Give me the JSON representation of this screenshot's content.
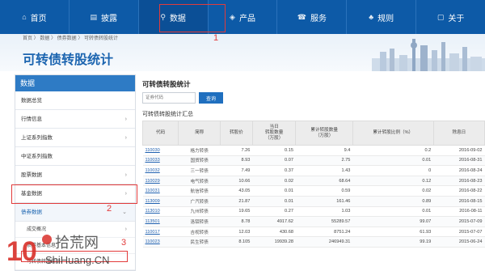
{
  "nav": [
    {
      "icon": "home-icon",
      "glyph": "⌂",
      "label": "首页"
    },
    {
      "icon": "disclosure-icon",
      "glyph": "▤",
      "label": "披露"
    },
    {
      "icon": "data-icon",
      "glyph": "⚲",
      "label": "数据"
    },
    {
      "icon": "product-icon",
      "glyph": "◈",
      "label": "产品"
    },
    {
      "icon": "service-icon",
      "glyph": "☎",
      "label": "服务"
    },
    {
      "icon": "rules-icon",
      "glyph": "♣",
      "label": "规则"
    },
    {
      "icon": "about-icon",
      "glyph": "▢",
      "label": "关于"
    }
  ],
  "breadcrumb": "首页 〉 数据 〉 债券数据 〉 可转债转股统计",
  "page_title": "可转债转股统计",
  "sidebar": {
    "header": "数据",
    "items": [
      {
        "label": "数据总览",
        "chevron": ""
      },
      {
        "label": "行情信息",
        "chevron": "›"
      },
      {
        "label": "上证系列指数",
        "chevron": "›"
      },
      {
        "label": "中证系列指数",
        "chevron": ""
      },
      {
        "label": "股票数据",
        "chevron": "›"
      },
      {
        "label": "基金数据",
        "chevron": "›"
      },
      {
        "label": "债券数据",
        "chevron": "⌄"
      }
    ],
    "subitems": [
      {
        "label": "成交概况",
        "chevron": "›"
      },
      {
        "label": "债券基本信息",
        "chevron": ""
      },
      {
        "label": "可转债转股统计",
        "chevron": ""
      }
    ]
  },
  "main": {
    "title": "可转债转股统计",
    "search_placeholder": "证券代码",
    "search_button": "查询",
    "summary_title": "可转债转股统计汇总",
    "columns": [
      "代码",
      "简称",
      "转股价",
      "当日\n转股数量\n（万股）",
      "累计转股数量\n（万股）",
      "累计转股比例（%）",
      "除息日"
    ],
    "rows": [
      [
        "110030",
        "格力转债",
        "7.26",
        "0.15",
        "9.4",
        "0.2",
        "2016-09-02"
      ],
      [
        "110033",
        "国贸转债",
        "8.93",
        "0.07",
        "2.75",
        "0.01",
        "2016-08-31"
      ],
      [
        "110032",
        "三一转债",
        "7.49",
        "0.37",
        "1.43",
        "0",
        "2016-08-24"
      ],
      [
        "110029",
        "电气转债",
        "10.66",
        "0.02",
        "68.64",
        "0.12",
        "2016-08-23"
      ],
      [
        "110031",
        "航信转债",
        "43.05",
        "0.01",
        "0.59",
        "0.02",
        "2016-08-22"
      ],
      [
        "113009",
        "广汽转债",
        "21.87",
        "0.01",
        "161.46",
        "0.89",
        "2016-08-15"
      ],
      [
        "113010",
        "九州转债",
        "19.65",
        "0.27",
        "1.03",
        "0.01",
        "2016-08-11"
      ],
      [
        "113501",
        "洛钼转债",
        "8.78",
        "4917.62",
        "55289.57",
        "99.07",
        "2015-07-09"
      ],
      [
        "110017",
        "吉视转债",
        "12.03",
        "430.68",
        "8751.24",
        "61.93",
        "2015-07-07"
      ],
      [
        "110023",
        "民生转债",
        "8.105",
        "19939.28",
        "246949.31",
        "99.19",
        "2015-06-24"
      ]
    ]
  },
  "annotations": [
    "1",
    "2",
    "3"
  ],
  "watermark": {
    "line1": "拾荒网",
    "line2": "ShiHuang.CN",
    "logo": "10"
  },
  "colors": {
    "nav": "#0d5aa7",
    "accent": "#1c65b0",
    "sidebar_head": "#2e7bc5",
    "annotation": "#e23b3b"
  }
}
